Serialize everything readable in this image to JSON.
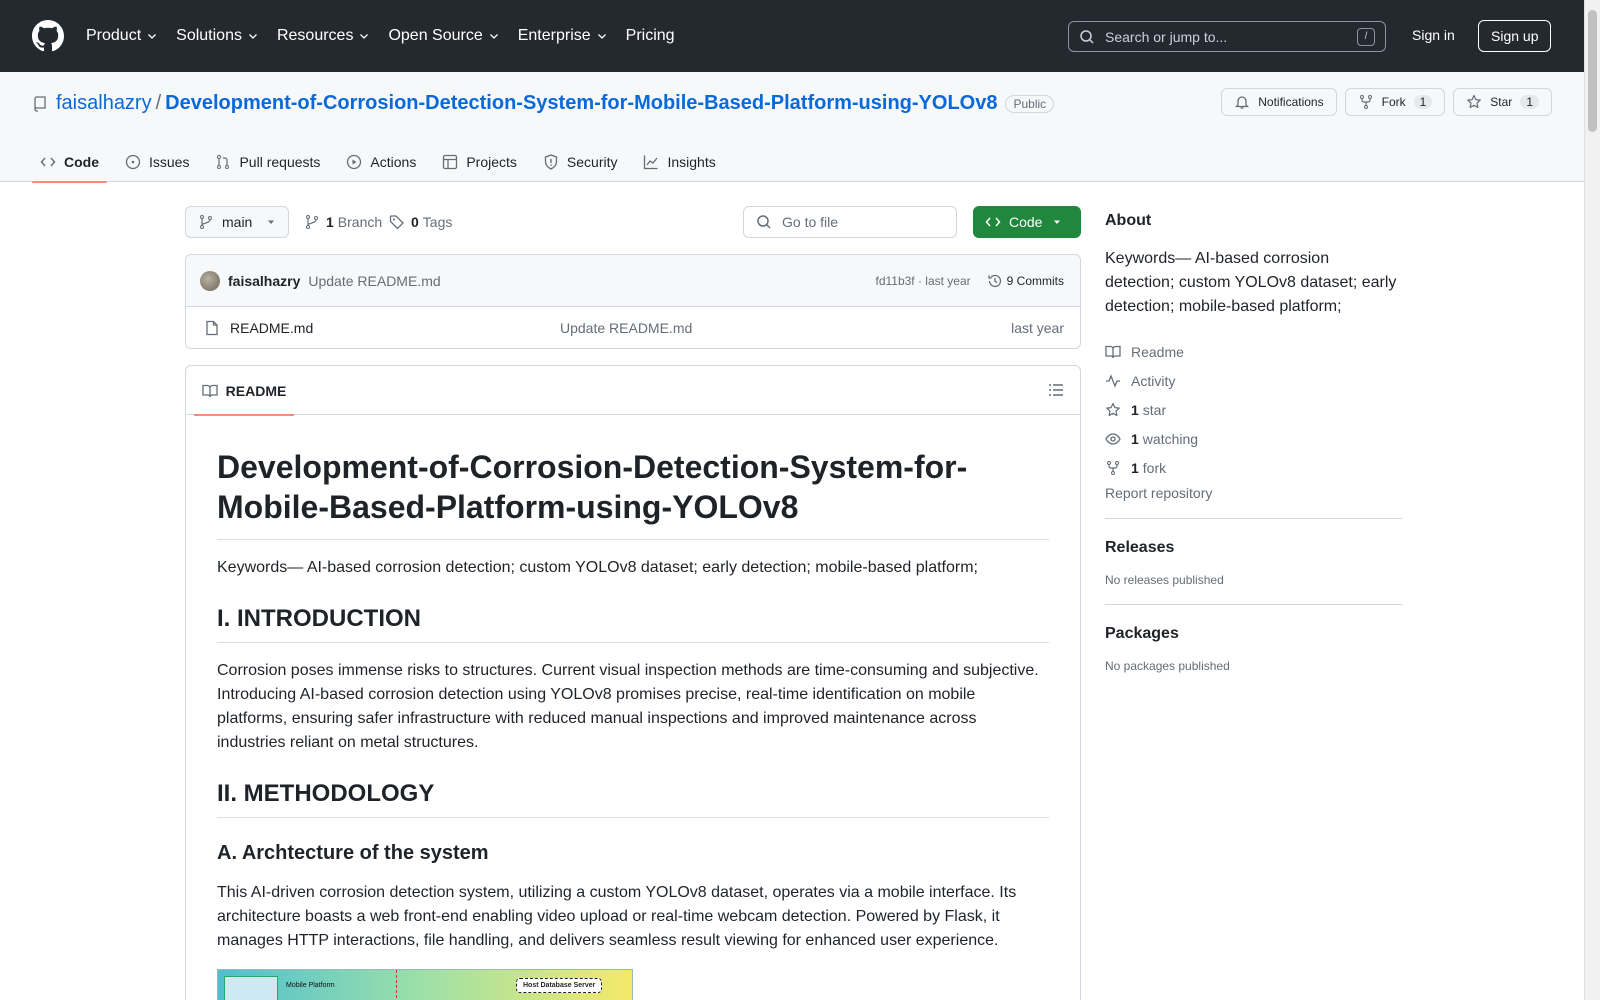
{
  "header": {
    "nav": [
      {
        "label": "Product",
        "dropdown": true
      },
      {
        "label": "Solutions",
        "dropdown": true
      },
      {
        "label": "Resources",
        "dropdown": true
      },
      {
        "label": "Open Source",
        "dropdown": true
      },
      {
        "label": "Enterprise",
        "dropdown": true
      },
      {
        "label": "Pricing",
        "dropdown": false
      }
    ],
    "search_placeholder": "Search or jump to...",
    "search_key": "/",
    "signin": "Sign in",
    "signup": "Sign up"
  },
  "repo": {
    "owner": "faisalhazry",
    "separator": "/",
    "name": "Development-of-Corrosion-Detection-System-for-Mobile-Based-Platform-using-YOLOv8",
    "visibility": "Public",
    "actions": {
      "notifications": "Notifications",
      "fork": "Fork",
      "fork_count": "1",
      "star": "Star",
      "star_count": "1"
    },
    "tabs": [
      "Code",
      "Issues",
      "Pull requests",
      "Actions",
      "Projects",
      "Security",
      "Insights"
    ],
    "active_tab": "Code"
  },
  "toolbar": {
    "branch": "main",
    "branch_count": "1",
    "branch_label": "Branch",
    "tag_count": "0",
    "tag_label": "Tags",
    "goto_placeholder": "Go to file",
    "code_button": "Code"
  },
  "commit": {
    "author": "faisalhazry",
    "message": "Update README.md",
    "hash": "fd11b3f · last year",
    "commits": "9 Commits"
  },
  "files": [
    {
      "name": "README.md",
      "message": "Update README.md",
      "date": "last year"
    }
  ],
  "readme": {
    "tab": "README",
    "title": "Development-of-Corrosion-Detection-System-for-Mobile-Based-Platform-using-YOLOv8",
    "keywords": "Keywords— AI-based corrosion detection; custom YOLOv8 dataset; early detection; mobile-based platform;",
    "h_intro": "I. INTRODUCTION",
    "intro": "Corrosion poses immense risks to structures. Current visual inspection methods are time-consuming and subjective. Introducing AI-based corrosion detection using YOLOv8 promises precise, real-time identification on mobile platforms, ensuring safer infrastructure with reduced manual inspections and improved maintenance across industries reliant on metal structures.",
    "h_method": "II. METHODOLOGY",
    "h_arch": "A. Archtecture of the system",
    "arch": "This AI-driven corrosion detection system, utilizing a custom YOLOv8 dataset, operates via a mobile interface. Its architecture boasts a web front-end enabling video upload or real-time webcam detection. Powered by Flask, it manages HTTP interactions, file handling, and delivers seamless result viewing for enhanced user experience.",
    "figure_labels": {
      "left": "Mobile Platform",
      "right": "Host Database Server"
    }
  },
  "sidebar": {
    "about_title": "About",
    "about_desc": "Keywords— AI-based corrosion detection; custom YOLOv8 dataset; early detection; mobile-based platform;",
    "readme": "Readme",
    "activity": "Activity",
    "stars_count": "1",
    "stars_label": "star",
    "watching_count": "1",
    "watching_label": "watching",
    "forks_count": "1",
    "forks_label": "fork",
    "report": "Report repository",
    "releases_title": "Releases",
    "releases_note": "No releases published",
    "packages_title": "Packages",
    "packages_note": "No packages published"
  }
}
